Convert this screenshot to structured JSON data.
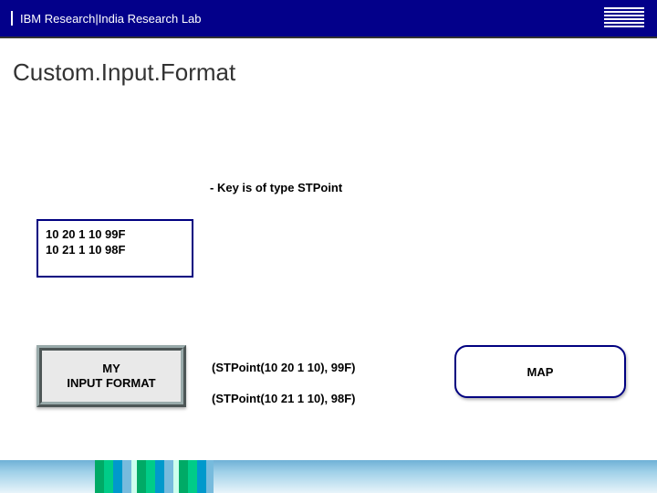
{
  "header": {
    "org": "IBM Research",
    "sep": "  |  ",
    "lab": "India Research Lab",
    "logo_label": "IBM"
  },
  "title": "Custom.Input.Format",
  "bullet": "Key is of type STPoint",
  "data_lines": {
    "l1": "10 20 1 10 99F",
    "l2": "10 21 1 10 98F"
  },
  "fmt_label": "MY\nINPUT FORMAT",
  "kv1": "(STPoint(10 20 1 10), 99F)",
  "kv2": "(STPoint(10 21 1 10), 98F)",
  "map_label": "MAP"
}
